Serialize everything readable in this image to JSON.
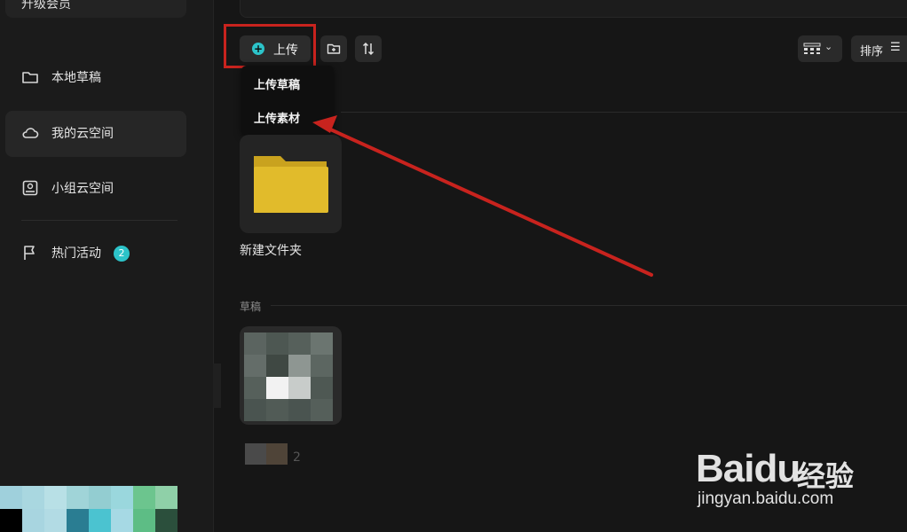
{
  "sidebar": {
    "top_label": "升级会员",
    "items": [
      {
        "label": "本地草稿",
        "icon": "folder-icon"
      },
      {
        "label": "我的云空间",
        "icon": "cloud-icon",
        "active": true
      },
      {
        "label": "小组云空间",
        "icon": "team-space-icon"
      },
      {
        "label": "热门活动",
        "icon": "flag-icon",
        "badge": "2"
      }
    ]
  },
  "toolbar": {
    "upload_label": "上传",
    "upload_menu": [
      "上传草稿",
      "上传素材"
    ],
    "sort_label": "排序"
  },
  "content": {
    "folders": [
      {
        "name": "新建文件夹"
      }
    ],
    "drafts_section_label": "草稿",
    "draft_items": [
      {
        "name": "2"
      }
    ]
  },
  "watermark": {
    "brand": "Baidu",
    "cn": "经验",
    "url": "jingyan.baidu.com"
  },
  "colors": {
    "accent": "#2cc3c9",
    "annotation": "#c8231e",
    "folder": "#e6be2a"
  }
}
